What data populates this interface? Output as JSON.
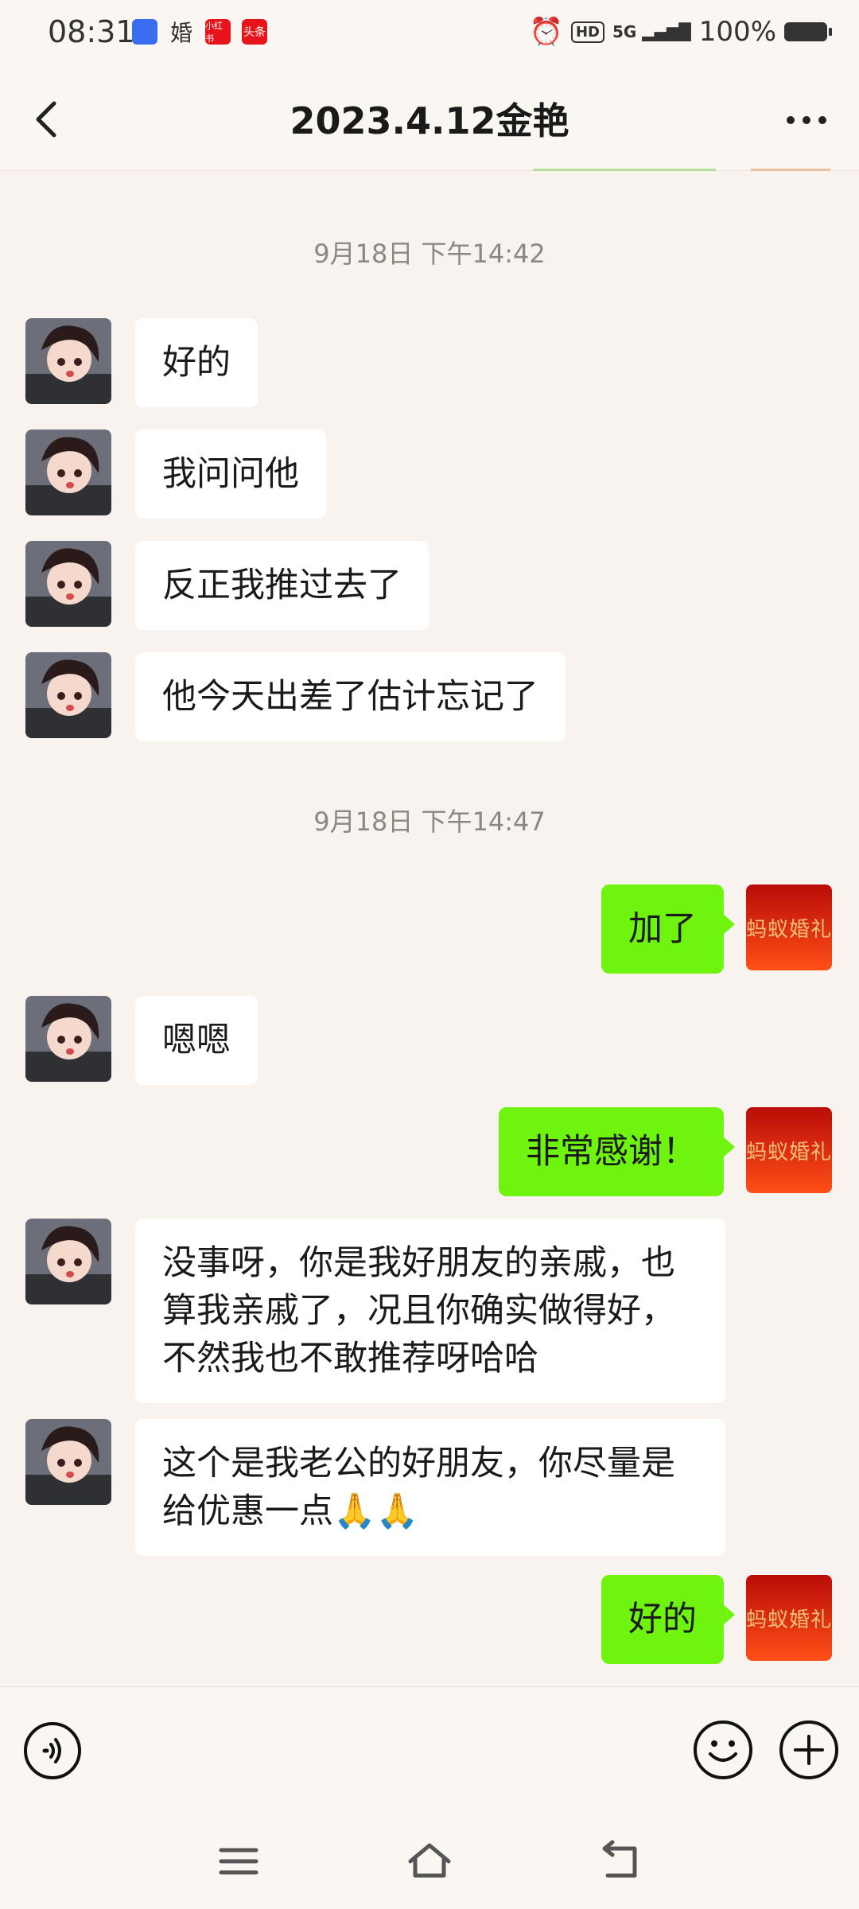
{
  "status_bar": {
    "time": "08:31",
    "apps": [
      {
        "label": "",
        "color": "#3b6df0"
      },
      {
        "label": "婚",
        "color": "transparent"
      },
      {
        "label": "小红书",
        "color": "#e8141c"
      },
      {
        "label": "头条",
        "color": "#e8141c"
      }
    ],
    "hd": "HD",
    "network": "5G",
    "battery": "100%"
  },
  "header": {
    "title": "2023.4.12金艳"
  },
  "messages": [
    {
      "type": "time",
      "text": "9月18日 下午14:42"
    },
    {
      "side": "left",
      "text": "好的"
    },
    {
      "side": "left",
      "text": "我问问他"
    },
    {
      "side": "left",
      "text": "反正我推过去了"
    },
    {
      "side": "left",
      "text": "他今天出差了估计忘记了"
    },
    {
      "type": "time",
      "text": "9月18日 下午14:47"
    },
    {
      "side": "right",
      "text": "加了"
    },
    {
      "side": "left",
      "text": "嗯嗯"
    },
    {
      "side": "right",
      "text": "非常感谢！"
    },
    {
      "side": "left",
      "text": "没事呀，你是我好朋友的亲戚，也算我亲戚了，况且你确实做得好，不然我也不敢推荐呀哈哈"
    },
    {
      "side": "left",
      "text": "这个是我老公的好朋友，你尽量是给优惠一点🙏🙏"
    },
    {
      "side": "right",
      "text": "好的"
    }
  ],
  "brand_avatar_text": "蚂蚁婚礼",
  "colors": {
    "background": "#f8f3ef",
    "outgoing_bubble": "#6ef40f",
    "incoming_bubble": "#ffffff",
    "brand_red": "#d11a0c"
  },
  "icons": {
    "back": "chevron-left-icon",
    "more": "more-dots-icon",
    "voice": "voice-icon",
    "emoji": "emoji-icon",
    "plus": "plus-icon",
    "nav_menu": "menu-icon",
    "nav_home": "home-icon",
    "nav_back": "back-icon"
  }
}
